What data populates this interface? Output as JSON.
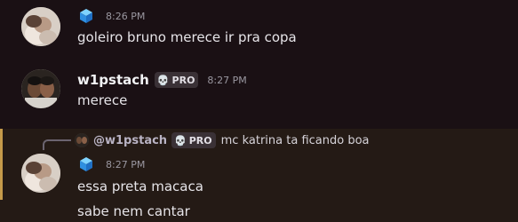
{
  "messages": [
    {
      "time": "8:26 PM",
      "text": "goleiro bruno merece ir pra copa",
      "tag_icon": "blue-cube-icon"
    },
    {
      "author": "w1pstach",
      "badge": "PRO",
      "badge_icon": "skull-icon",
      "time": "8:27 PM",
      "text": "merece"
    },
    {
      "reply": {
        "author": "@w1pstach",
        "badge": "PRO",
        "text": "mc katrina ta ficando boa"
      },
      "time": "8:27 PM",
      "tag_icon": "blue-cube-icon",
      "lines": [
        "essa preta macaca",
        "sabe nem cantar"
      ]
    }
  ],
  "colors": {
    "background": "#1a1014",
    "highlight_background": "#241a15",
    "mention_bar": "#c59a4a",
    "name": "#f2f3f5",
    "timestamp": "#9a97a0"
  }
}
